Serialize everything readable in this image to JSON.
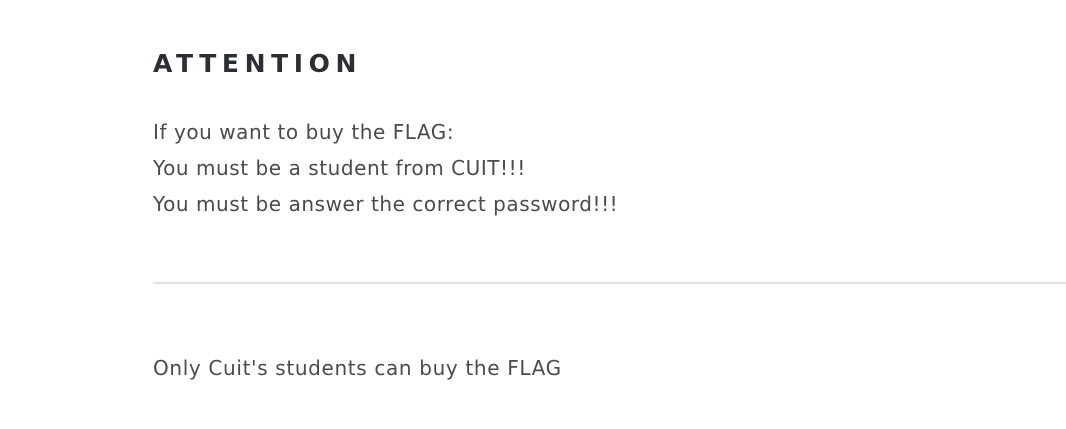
{
  "heading": "ATTENTION",
  "notice": {
    "lines": [
      "If you want to buy the FLAG:",
      "You must be a student from CUIT!!!",
      "You must be answer the correct password!!!"
    ]
  },
  "footer": {
    "text": "Only Cuit's students can buy the FLAG"
  }
}
